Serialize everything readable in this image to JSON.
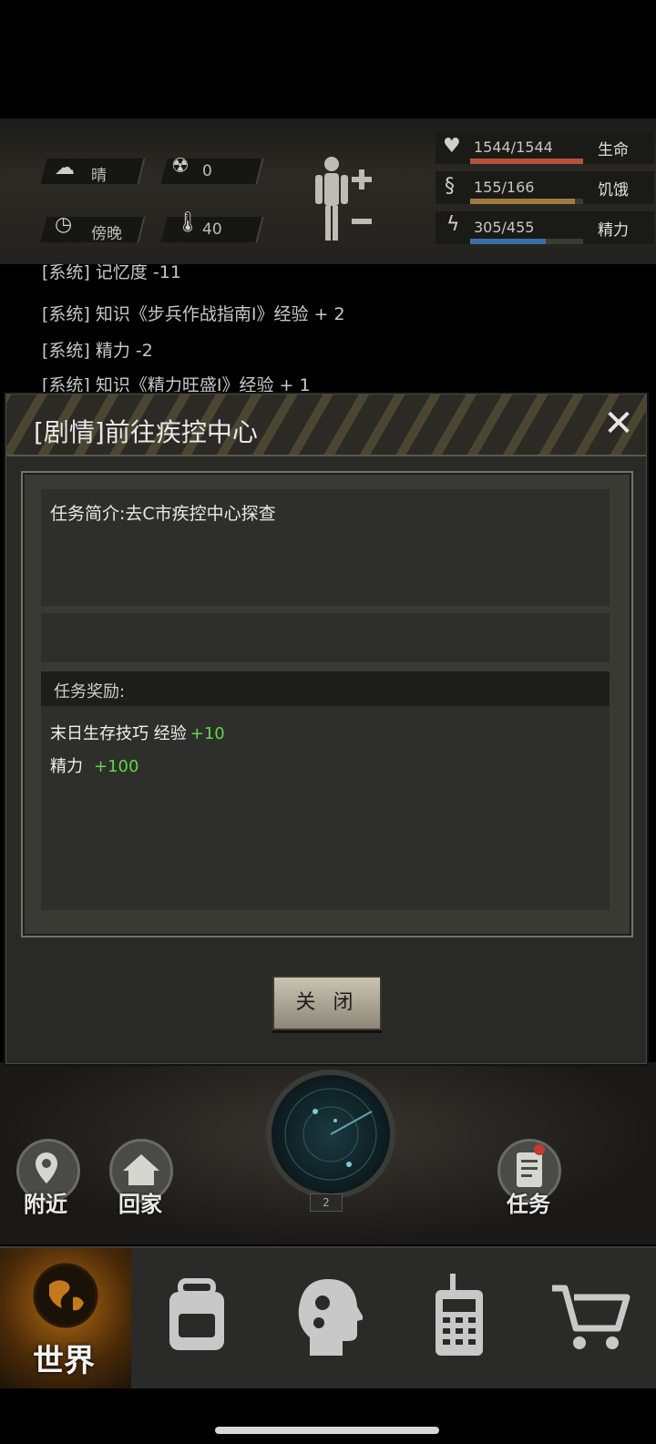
{
  "status": {
    "weather": "晴",
    "radiation": "0",
    "time_of_day": "傍晚",
    "temperature": "40",
    "stats": [
      {
        "value": "1544/1544",
        "label": "生命",
        "fraction": 1.0,
        "color": "#b5533e"
      },
      {
        "value": "155/166",
        "label": "饥饿",
        "fraction": 0.93,
        "color": "#a07a40"
      },
      {
        "value": "305/455",
        "label": "精力",
        "fraction": 0.67,
        "color": "#3a6fa6"
      }
    ]
  },
  "log": {
    "lines": [
      "[系统] 记忆度 -11",
      "[系统] 知识《步兵作战指南Ⅰ》经验 + 2",
      "[系统] 精力 -2",
      "[系统] 知识《精力旺盛Ⅰ》经验 + 1"
    ]
  },
  "dialog": {
    "title": "[剧情]前往疾控中心",
    "close_icon": "✕",
    "description": "任务简介:去C市疾控中心探查",
    "reward_header": "任务奖励:",
    "rewards": [
      {
        "text": "末日生存技巧 经验",
        "amount": "+10"
      },
      {
        "text": "精力",
        "amount": "+100"
      }
    ],
    "close_button": "关 闭"
  },
  "map": {
    "nearby": "附近",
    "home": "回家",
    "radar_count": "2",
    "tasks": "任务"
  },
  "nav": {
    "world": "世界",
    "items": [
      "backpack-icon",
      "skills-icon",
      "radio-icon",
      "cart-icon"
    ]
  }
}
